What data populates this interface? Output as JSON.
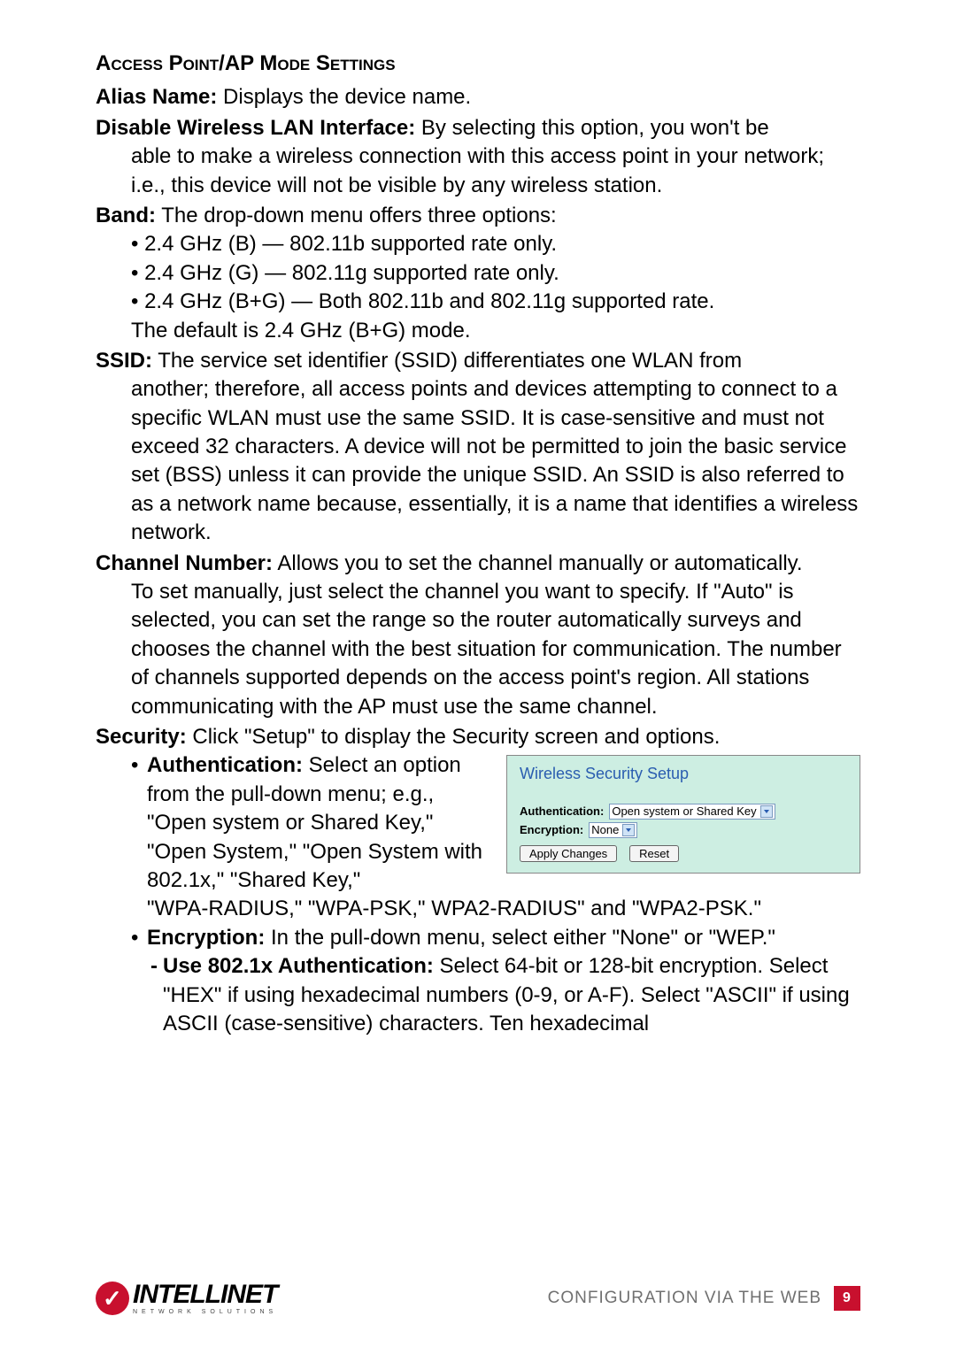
{
  "heading": "Access Point/AP Mode Settings",
  "alias_name_term": "Alias Name:",
  "alias_name_text": " Displays the device name.",
  "disable_term": "Disable Wireless LAN Interface:",
  "disable_text": " By selecting this option, you won't be able to make a wireless connection with this access point in your network; i.e., this device will not be visible by any wireless station.",
  "band_term": "Band:",
  "band_text": " The drop-down menu offers three options:",
  "band_b": "• 2.4 GHz (B) — 802.11b supported rate only.",
  "band_g": "• 2.4 GHz (G) — 802.11g supported rate only.",
  "band_bg": "• 2.4 GHz (B+G) — Both 802.11b and 802.11g supported rate.",
  "band_default": "The default is 2.4 GHz (B+G) mode.",
  "ssid_term": "SSID:",
  "ssid_text": " The service set identifier (SSID) differentiates one WLAN from another; therefore, all access points and devices attempting to connect to a specific WLAN must use the same SSID. It is case-sensitive and must not exceed 32 characters. A device will not be permitted to join the basic service set (BSS) unless it can provide the unique SSID. An SSID is also referred to as a network name because, essentially, it is a name that identifies a wireless network.",
  "channel_term": "Channel Number:",
  "channel_text": " Allows you to set the channel manually or automatically. To set manually, just select the channel you want to specify. If \"Auto\" is selected, you can set the range so the router automatically surveys and chooses the channel with the best situation for communication. The number of channels supported depends on the access point's region. All stations communicating with the AP must use the same channel.",
  "security_term": "Security:",
  "security_text": " Click \"Setup\" to display the Security screen and options.",
  "auth_term": "Authentication:",
  "auth_text_a": " Select an option from the pull-down menu; e.g., \"Open system or Shared Key,\" \"Open System,\" \"Open System with 802.1x,\" \"Shared Key,\"",
  "auth_text_b": "\"WPA-RADIUS,\" \"WPA-PSK,\" WPA2-RADIUS\" and \"WPA2-PSK.\"",
  "enc_term": "Encryption:",
  "enc_text": " In the pull-down menu, select either \"None\" or \"WEP.\"",
  "use8021x_term": "Use 802.1x Authentication:",
  "use8021x_text": " Select 64-bit or 128-bit encryption. Select \"HEX\" if using hexadecimal numbers (0-9, or A-F). Select \"ASCII\" if using ASCII (case-sensitive) characters. Ten hexadecimal",
  "panel": {
    "title": "Wireless Security Setup",
    "auth_label": "Authentication:",
    "auth_value": "Open system or Shared Key",
    "enc_label": "Encryption:",
    "enc_value": "None",
    "apply": "Apply Changes",
    "reset": "Reset"
  },
  "footer": {
    "brand": "INTELLINET",
    "brand_sub": "NETWORK SOLUTIONS",
    "section": "CONFIGURATION VIA THE WEB",
    "page": "9"
  }
}
